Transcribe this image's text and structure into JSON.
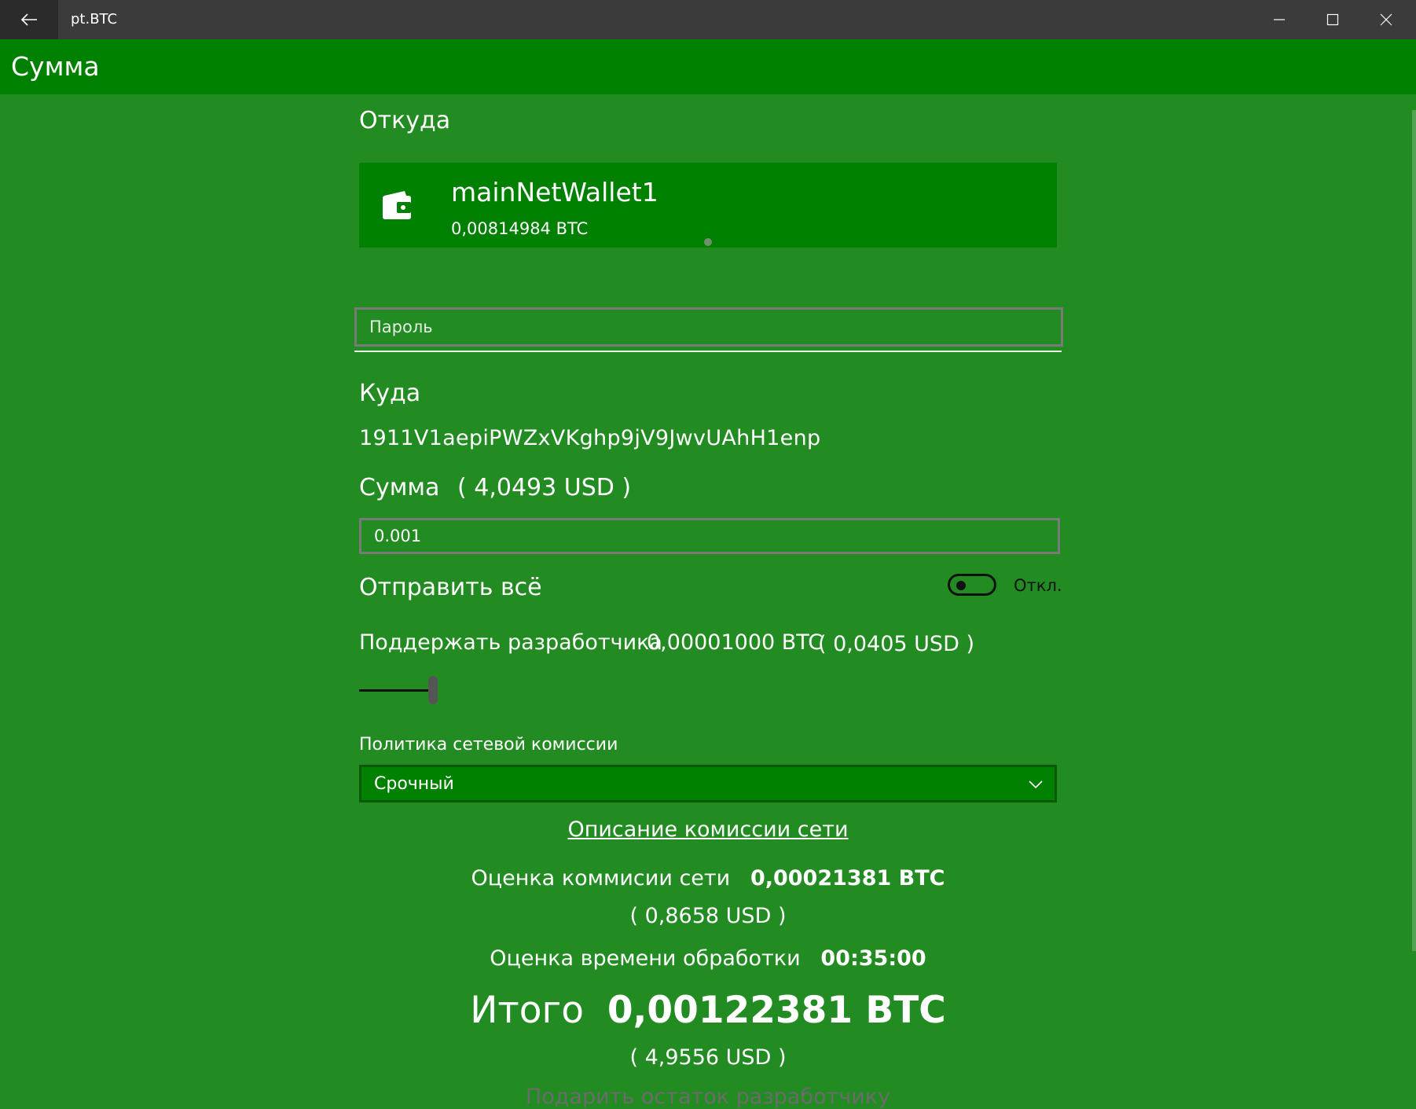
{
  "window": {
    "title": "pt.BTC",
    "back_icon": "back-arrow-icon",
    "controls": [
      "minimize-icon",
      "maximize-icon",
      "close-icon"
    ]
  },
  "header": {
    "title": "Сумма"
  },
  "from": {
    "label": "Откуда",
    "wallet": {
      "icon": "wallet-icon",
      "name": "mainNetWallet1",
      "balance": "0,00814984 BTC"
    }
  },
  "password": {
    "placeholder": "Пароль",
    "value": ""
  },
  "to": {
    "label": "Куда",
    "address": "1911V1aepiPWZxVKghp9jV9JwvUAhH1enp"
  },
  "amount": {
    "label": "Сумма",
    "usd": "( 4,0493 USD )",
    "value": "0.001"
  },
  "send_all": {
    "label": "Отправить всё",
    "state_label": "Откл.",
    "on": false
  },
  "support_dev": {
    "label": "Поддержать разработчика",
    "btc": "0,00001000 BTC",
    "usd": "( 0,0405 USD )"
  },
  "fee_policy": {
    "label": "Политика сетевой комиссии",
    "selected": "Срочный",
    "link": "Описание комиссии сети"
  },
  "estimates": {
    "fee_label": "Оценка коммисии сети",
    "fee_btc": "0,00021381 BTC",
    "fee_usd": "( 0,8658 USD )",
    "time_label": "Оценка времени обработки",
    "time_value": "00:35:00"
  },
  "total": {
    "label": "Итого",
    "btc": "0,00122381 BTC",
    "usd": "( 4,9556 USD )"
  },
  "donate_remainder": "Подарить остаток разработчику",
  "colors": {
    "background": "#228b22",
    "header": "#008000",
    "titlebar": "#3b3b3b",
    "accent_dark": "#111111"
  }
}
